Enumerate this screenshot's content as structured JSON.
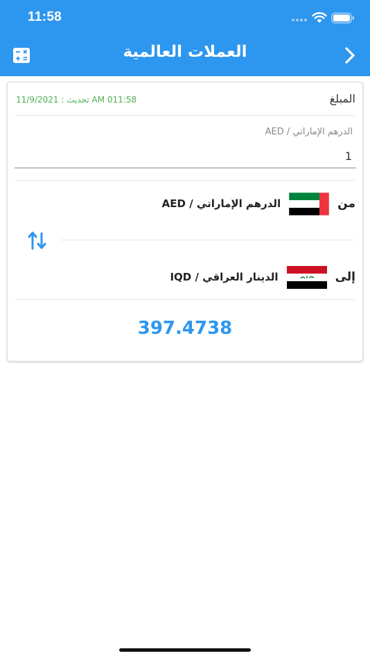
{
  "status_bar": {
    "time": "11:58"
  },
  "nav": {
    "title": "العملات العالمية",
    "left_icon": "calculator-icon",
    "right_icon": "chevron-right-icon"
  },
  "converter": {
    "amount_label": "المبلغ",
    "update_text": "تحديث : 11/9/2021  AM 011:58",
    "input_label": "الدرهم الإماراتي / AED",
    "amount_value": "1",
    "from_label": "من",
    "from_currency": "الدرهم الإماراتي / AED",
    "from_flag": "uae-flag-icon",
    "swap_icon": "swap-arrows-icon",
    "to_label": "إلى",
    "to_currency": "الدينار العراقي / IQD",
    "to_flag": "iraq-flag-icon",
    "result": "397.4738"
  },
  "colors": {
    "primary": "#2d96ef",
    "update_green": "#4caf50"
  }
}
